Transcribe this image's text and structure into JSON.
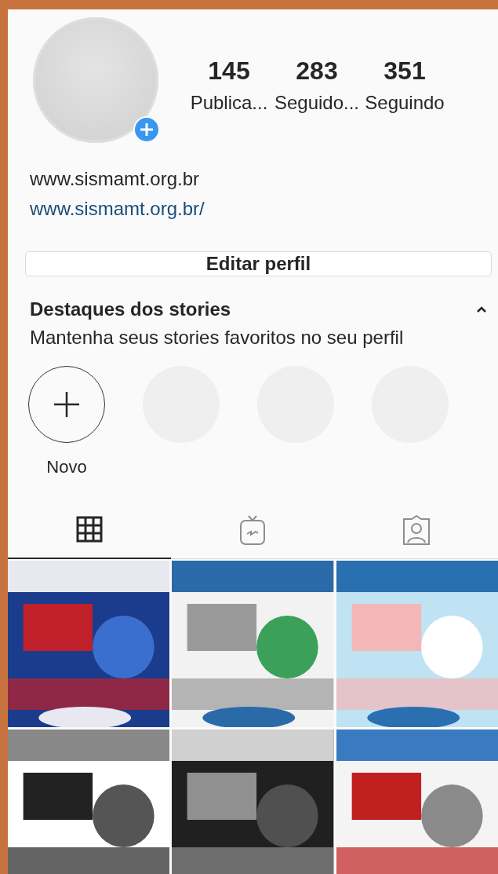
{
  "profile": {
    "stats": [
      {
        "value": "145",
        "label": "Publica..."
      },
      {
        "value": "283",
        "label": "Seguido..."
      },
      {
        "value": "351",
        "label": "Seguindo"
      }
    ],
    "bio_text": "www.sismamt.org.br",
    "website": "www.sismamt.org.br/"
  },
  "edit_button": "Editar perfil",
  "highlights": {
    "title": "Destaques dos stories",
    "subtitle": "Mantenha seus stories favoritos no seu perfil",
    "expanded": true,
    "items": [
      {
        "kind": "new",
        "label": "Novo"
      },
      {
        "kind": "placeholder"
      },
      {
        "kind": "placeholder"
      },
      {
        "kind": "placeholder"
      }
    ]
  },
  "tabs": [
    {
      "kind": "grid",
      "selected": true
    },
    {
      "kind": "tv",
      "selected": false
    },
    {
      "kind": "tagged",
      "selected": false
    }
  ]
}
